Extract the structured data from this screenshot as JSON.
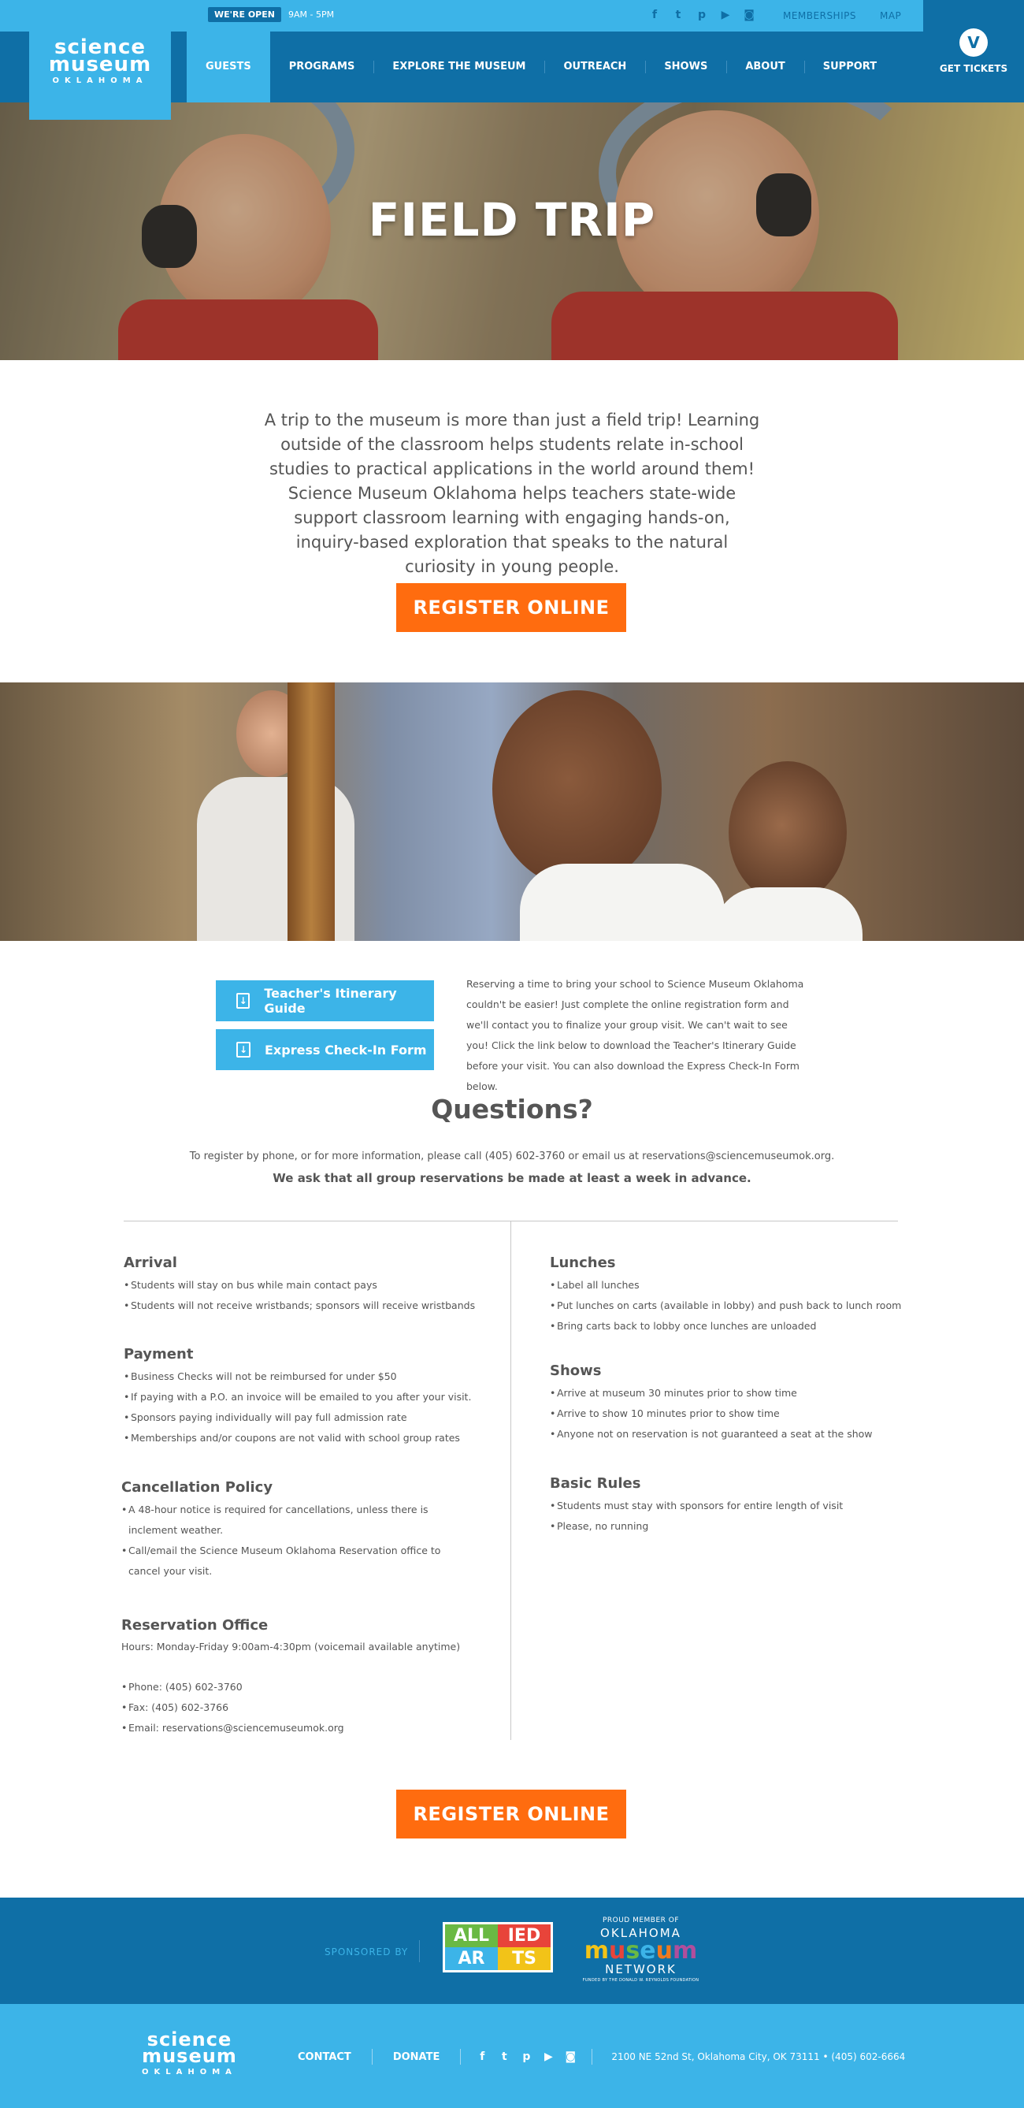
{
  "header": {
    "open_badge": "WE'RE OPEN",
    "hours": "9AM - 5PM",
    "social_icons": [
      "facebook-icon",
      "twitter-icon",
      "pinterest-icon",
      "youtube-icon",
      "instagram-icon"
    ],
    "top_links": [
      "MEMBERSHIPS",
      "MAP"
    ],
    "logo": {
      "line1": "science",
      "line2": "museum",
      "line3": "OKLAHOMA"
    },
    "nav": [
      "GUESTS",
      "PROGRAMS",
      "EXPLORE THE MUSEUM",
      "OUTREACH",
      "SHOWS",
      "ABOUT",
      "SUPPORT"
    ],
    "active_nav": "GUESTS",
    "tickets_label": "GET TICKETS"
  },
  "hero": {
    "title": "FIELD TRIP"
  },
  "intro": {
    "text": "A trip to the museum is more than just a field trip! Learning outside of the classroom helps students relate in-school studies to practical applications in the world around them! Science Museum Oklahoma helps teachers state-wide support classroom learning with engaging hands-on, inquiry-based exploration that speaks to the natural curiosity in young people.",
    "register_label": "REGISTER ONLINE"
  },
  "downloads": {
    "itinerary_label": "Teacher's Itinerary Guide",
    "checkin_label": "Express Check-In Form",
    "description": "Reserving a time to bring your school to Science Museum Oklahoma couldn't be easier! Just complete the online registration form and we'll contact you to finalize your group visit. We can't wait to see you! Click the link below to download the Teacher's Itinerary Guide before your visit. You can also download the Express Check-In Form below."
  },
  "questions": {
    "title": "Questions?",
    "line1": "To register by phone, or for more information, please call (405) 602-3760 or email us at reservations@sciencemuseumok.org.",
    "line2": "We ask that all group reservations be made at least a week in advance."
  },
  "left_sections": {
    "arrival": {
      "title": "Arrival",
      "items": [
        "Students will stay on bus while main contact pays",
        "Students will not receive wristbands; sponsors will receive wristbands"
      ]
    },
    "payment": {
      "title": "Payment",
      "items": [
        "Business Checks will not be reimbursed for under $50",
        "If paying with a P.O. an invoice will be emailed to you after your visit.",
        "Sponsors paying individually will pay full admission rate",
        "Memberships and/or coupons are not valid with school group rates"
      ]
    },
    "cancellation": {
      "title": "Cancellation Policy",
      "items": [
        "A 48-hour notice is required for cancellations, unless there is inclement weather.",
        "Call/email the Science Museum Oklahoma Reservation office to cancel your visit."
      ]
    },
    "reservation": {
      "title": "Reservation Office",
      "hours": "Hours: Monday-Friday 9:00am-4:30pm (voicemail available anytime)",
      "items": [
        "Phone: (405) 602-3760",
        "Fax: (405) 602-3766",
        "Email: reservations@sciencemuseumok.org"
      ]
    }
  },
  "right_sections": {
    "lunches": {
      "title": "Lunches",
      "items": [
        "Label all lunches",
        "Put lunches on carts (available in lobby) and push back to lunch room",
        "Bring carts back to lobby once lunches are unloaded"
      ]
    },
    "shows": {
      "title": "Shows",
      "items": [
        "Arrive at museum 30 minutes prior to show time",
        "Arrive to show 10 minutes prior to show time",
        "Anyone not on reservation is not guaranteed a seat at the show"
      ]
    },
    "rules": {
      "title": "Basic Rules",
      "items": [
        "Students must stay with sponsors for entire length of visit",
        "Please, no running"
      ]
    }
  },
  "bottom_register_label": "REGISTER ONLINE",
  "sponsors": {
    "sponsored_by": "SPONSORED BY",
    "allied": [
      "ALL",
      "IED",
      "AR",
      "TS"
    ],
    "omn_small": "PROUD MEMBER OF",
    "omn_line1": "OKLAHOMA",
    "omn_line2": [
      "m",
      "u",
      "s",
      "e",
      "u",
      "m"
    ],
    "omn_line3": "NETWORK",
    "omn_tiny": "FUNDED BY THE DONALD W. REYNOLDS FOUNDATION"
  },
  "footer": {
    "links": [
      "CONTACT",
      "DONATE"
    ],
    "social_icons": [
      "facebook-icon",
      "twitter-icon",
      "pinterest-icon",
      "youtube-icon",
      "instagram-icon"
    ],
    "address": "2100 NE 52nd St, Oklahoma City, OK 73111  •  (405) 602-6664"
  },
  "colors": {
    "light_blue": "#3cb4e8",
    "dark_blue": "#0f6fa6",
    "orange": "#ff6c0f",
    "text": "#555555"
  }
}
